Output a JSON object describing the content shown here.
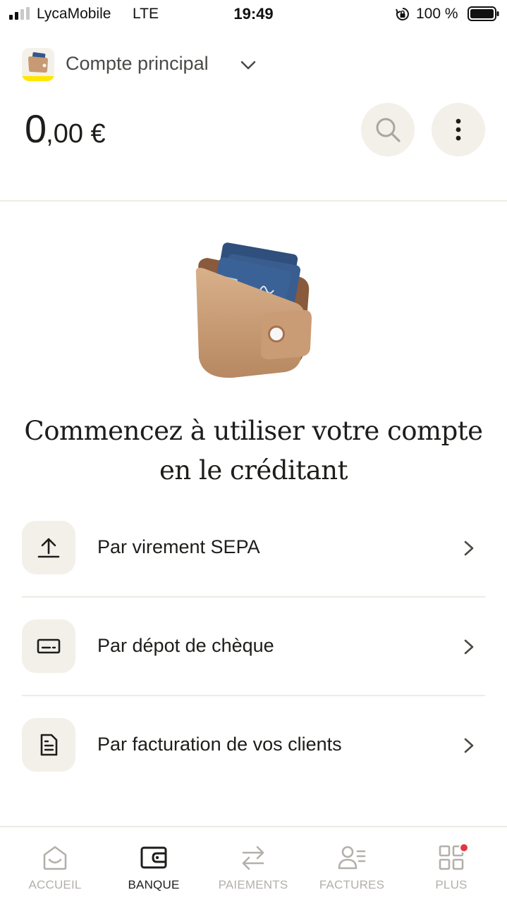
{
  "status_bar": {
    "carrier": "LycaMobile",
    "network": "LTE",
    "time": "19:49",
    "battery_percent": "100 %",
    "icons": [
      "signal-icon",
      "rotation-lock-icon",
      "battery-icon"
    ]
  },
  "account": {
    "name": "Compte principal",
    "balance_whole": "0",
    "balance_decimal": ",00 €",
    "icons": [
      "wallet-avatar-icon",
      "chevron-down-icon",
      "search-icon",
      "more-vertical-icon"
    ]
  },
  "empty_state": {
    "headline_line1": "Commencez à utiliser votre compte",
    "headline_line2": "en le créditant",
    "illustration": "wallet-illustration"
  },
  "options": [
    {
      "label": "Par virement SEPA",
      "icon": "upload-icon"
    },
    {
      "label": "Par dépot de chèque",
      "icon": "cheque-icon"
    },
    {
      "label": "Par facturation de vos clients",
      "icon": "invoice-icon"
    }
  ],
  "bottom_nav": {
    "active": "BANQUE",
    "items": [
      {
        "label": "ACCUEIL",
        "icon": "home-icon"
      },
      {
        "label": "BANQUE",
        "icon": "wallet-icon"
      },
      {
        "label": "PAIEMENTS",
        "icon": "transfer-arrows-icon"
      },
      {
        "label": "FACTURES",
        "icon": "invoices-person-icon"
      },
      {
        "label": "PLUS",
        "icon": "grid-icon"
      }
    ]
  },
  "colors": {
    "accent_yellow": "#ffe600",
    "surface_beige": "#f3f0ea",
    "text_dark": "#1d1d1b",
    "nav_inactive": "#b3b0aa",
    "notification_red": "#e0383e"
  }
}
